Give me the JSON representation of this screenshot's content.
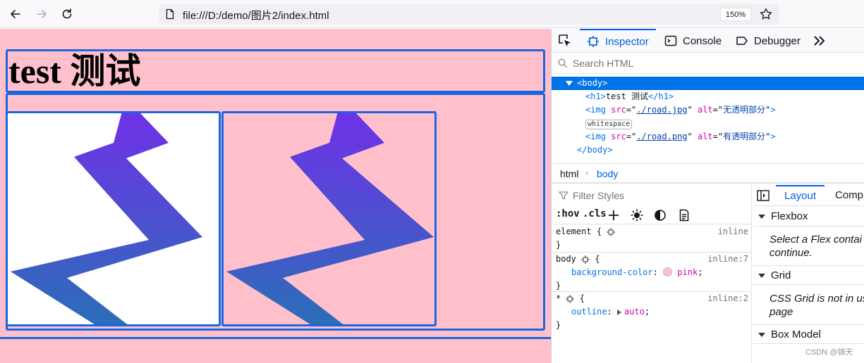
{
  "browser": {
    "url": "file:///D:/demo/图片2/index.html",
    "zoom": "150%",
    "icons": [
      "back-icon",
      "forward-icon",
      "reload-icon",
      "file-icon",
      "bookmark-star-icon"
    ]
  },
  "page": {
    "background": "#ffc0cb",
    "outline_color": "#1a65e0",
    "heading": "test 测试",
    "images": [
      {
        "alt": "无透明部分",
        "background": "#ffffff"
      },
      {
        "alt": "有透明部分",
        "background": "transparent"
      }
    ]
  },
  "devtools": {
    "tabs": [
      {
        "label": "Inspector",
        "icon": "inspector-icon",
        "active": true
      },
      {
        "label": "Console",
        "icon": "console-icon",
        "active": false
      },
      {
        "label": "Debugger",
        "icon": "debugger-icon",
        "active": false
      }
    ],
    "search_placeholder": "Search HTML",
    "markup": {
      "body_open": "<body>",
      "h1_open": "<h1>",
      "h1_text": "test 测试",
      "h1_close": "</h1>",
      "img1": {
        "tag": "<img",
        "src_attr": "src",
        "src": "./road.jpg",
        "alt_attr": "alt",
        "alt": "无透明部分",
        "close": ">"
      },
      "whitespace": "whitespace",
      "img2": {
        "tag": "<img",
        "src_attr": "src",
        "src": "./road.png",
        "alt_attr": "alt",
        "alt": "有透明部分",
        "close": ">"
      },
      "body_close": "</body>"
    },
    "breadcrumb": [
      "html",
      "body"
    ],
    "filter_placeholder": "Filter Styles",
    "rule_tools": {
      "hov": ":hov",
      "cls": ".cls"
    },
    "rules": [
      {
        "selector": "element",
        "open": "{",
        "close": "}",
        "source": "inline"
      },
      {
        "selector": "body",
        "open": "{",
        "close": "}",
        "source": "inline:7",
        "prop": "background-color",
        "colon": ":",
        "value": "pink",
        "semi": ";"
      },
      {
        "selector": "*",
        "open": "{",
        "close": "}",
        "source": "inline:2",
        "prop": "outline",
        "colon": ":",
        "value": "auto",
        "semi": ";"
      }
    ],
    "layout_tabs": [
      "Layout",
      "Comp"
    ],
    "sections": [
      {
        "title": "Flexbox",
        "note": "Select a Flex contai",
        "note2": "continue."
      },
      {
        "title": "Grid",
        "note": "CSS Grid is not in us",
        "note2": "page"
      },
      {
        "title": "Box Model"
      }
    ],
    "watermark": "CSDN @锦天"
  }
}
